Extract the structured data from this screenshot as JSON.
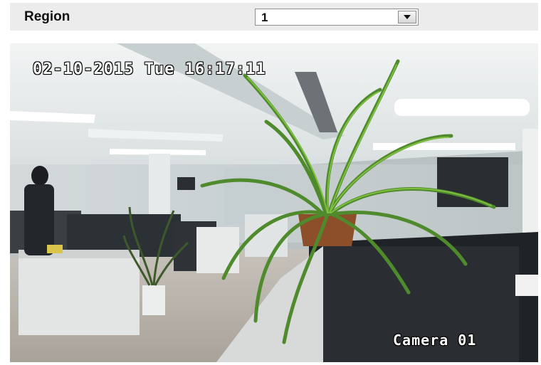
{
  "region": {
    "label": "Region",
    "selected_value": "1"
  },
  "video": {
    "timestamp": "02-10-2015 Tue 16:17:11",
    "camera_name": "Camera 01"
  },
  "icons": {
    "dropdown": "chevron-down-icon"
  },
  "colors": {
    "bar_background": "#ececec",
    "osd_text": "#ffffff"
  }
}
